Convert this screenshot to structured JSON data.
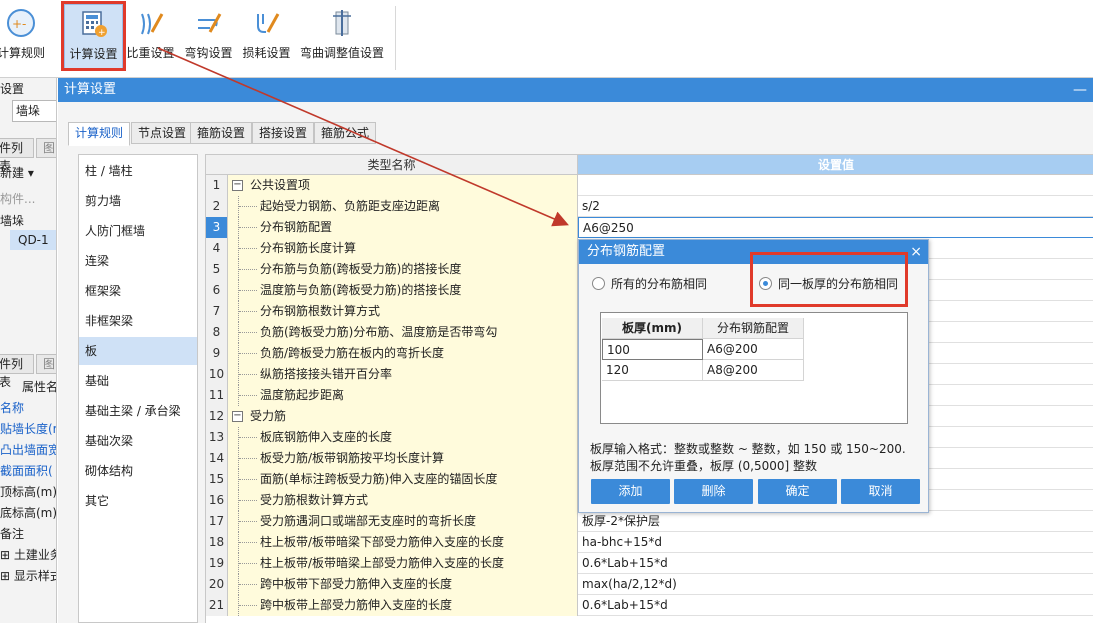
{
  "ribbon": {
    "buttons": [
      {
        "label": "计算规则",
        "icon": "calc-rule-icon"
      },
      {
        "label": "计算设置",
        "icon": "calc-settings-icon",
        "active": true
      },
      {
        "label": "比重设置",
        "icon": "density-icon"
      },
      {
        "label": "弯钩设置",
        "icon": "hook-icon"
      },
      {
        "label": "损耗设置",
        "icon": "loss-icon"
      },
      {
        "label": "弯曲调整值设置",
        "icon": "bend-adjust-icon"
      }
    ]
  },
  "left_panel": {
    "section_label": "设置",
    "dropdown_value": "墙垛",
    "tab1": "件列表",
    "tab1_extra": "图",
    "new_label": "新建",
    "search_placeholder": "构件...",
    "tree_parent": "墙垛",
    "tree_child": "QD-1",
    "tab2": "件列表",
    "tab2_extra": "图",
    "prop_header": "属性名",
    "props": [
      {
        "text": "名称",
        "blue": true
      },
      {
        "text": "贴墙长度(r",
        "blue": true
      },
      {
        "text": "凸出墙面宽",
        "blue": true
      },
      {
        "text": "截面面积(",
        "blue": true
      },
      {
        "text": "顶标高(m)",
        "blue": false
      },
      {
        "text": "底标高(m)",
        "blue": false
      },
      {
        "text": "备注",
        "blue": false
      },
      {
        "text": "土建业务",
        "blue": false
      },
      {
        "text": "显示样式",
        "blue": false
      }
    ]
  },
  "window": {
    "title": "计算设置",
    "minimize": "—",
    "tabs": [
      "计算规则",
      "节点设置",
      "箍筋设置",
      "搭接设置",
      "箍筋公式"
    ],
    "categories": [
      "柱 / 墙柱",
      "剪力墙",
      "人防门框墙",
      "连梁",
      "框架梁",
      "非框架梁",
      "板",
      "基础",
      "基础主梁 / 承台梁",
      "基础次梁",
      "砌体结构",
      "其它"
    ],
    "grid": {
      "col_name": "类型名称",
      "col_value": "设置值",
      "rows": [
        {
          "no": "1",
          "name": "公共设置项",
          "value": "",
          "group": true,
          "exp": "−"
        },
        {
          "no": "2",
          "name": "起始受力钢筋、负筋距支座边距离",
          "value": "s/2"
        },
        {
          "no": "3",
          "name": "分布钢筋配置",
          "value": "A6@250",
          "current": true
        },
        {
          "no": "4",
          "name": "分布钢筋长度计算",
          "value": ""
        },
        {
          "no": "5",
          "name": "分布筋与负筋(跨板受力筋)的搭接长度",
          "value": ""
        },
        {
          "no": "6",
          "name": "温度筋与负筋(跨板受力筋)的搭接长度",
          "value": ""
        },
        {
          "no": "7",
          "name": "分布钢筋根数计算方式",
          "value": ""
        },
        {
          "no": "8",
          "name": "负筋(跨板受力筋)分布筋、温度筋是否带弯勾",
          "value": ""
        },
        {
          "no": "9",
          "name": "负筋/跨板受力筋在板内的弯折长度",
          "value": ""
        },
        {
          "no": "10",
          "name": "纵筋搭接接头错开百分率",
          "value": ""
        },
        {
          "no": "11",
          "name": "温度筋起步距离",
          "value": ""
        },
        {
          "no": "12",
          "name": "受力筋",
          "value": "",
          "group": true,
          "exp": "−"
        },
        {
          "no": "13",
          "name": "板底钢筋伸入支座的长度",
          "value": ""
        },
        {
          "no": "14",
          "name": "板受力筋/板带钢筋按平均长度计算",
          "value": ""
        },
        {
          "no": "15",
          "name": "面筋(单标注跨板受力筋)伸入支座的锚固长度",
          "value": ""
        },
        {
          "no": "16",
          "name": "受力筋根数计算方式",
          "value": ""
        },
        {
          "no": "17",
          "name": "受力筋遇洞口或端部无支座时的弯折长度",
          "value": "板厚-2*保护层"
        },
        {
          "no": "18",
          "name": "柱上板带/板带暗梁下部受力筋伸入支座的长度",
          "value": "ha-bhc+15*d"
        },
        {
          "no": "19",
          "name": "柱上板带/板带暗梁上部受力筋伸入支座的长度",
          "value": "0.6*Lab+15*d"
        },
        {
          "no": "20",
          "name": "跨中板带下部受力筋伸入支座的长度",
          "value": "max(ha/2,12*d)"
        },
        {
          "no": "21",
          "name": "跨中板带上部受力筋伸入支座的长度",
          "value": "0.6*Lab+15*d"
        }
      ]
    }
  },
  "dialog": {
    "title": "分布钢筋配置",
    "close": "×",
    "radio_all": "所有的分布筋相同",
    "radio_same_thickness": "同一板厚的分布筋相同",
    "table": {
      "col1": "板厚(mm)",
      "col2": "分布钢筋配置",
      "rows": [
        {
          "thickness": "100",
          "config": "A6@200"
        },
        {
          "thickness": "120",
          "config": "A8@200"
        }
      ]
    },
    "hint1": "板厚输入格式：整数或整数 ~ 整数，如 150 或 150~200.",
    "hint2": "板厚范围不允许重叠，板厚 (0,5000] 整数",
    "buttons": {
      "add": "添加",
      "delete": "删除",
      "ok": "确定",
      "cancel": "取消"
    }
  },
  "colors": {
    "accent": "#3b8ad9",
    "highlight_red": "#e03a2b",
    "name_cell_bg": "#fffbdc",
    "value_header_bg": "#a7cdf2"
  }
}
